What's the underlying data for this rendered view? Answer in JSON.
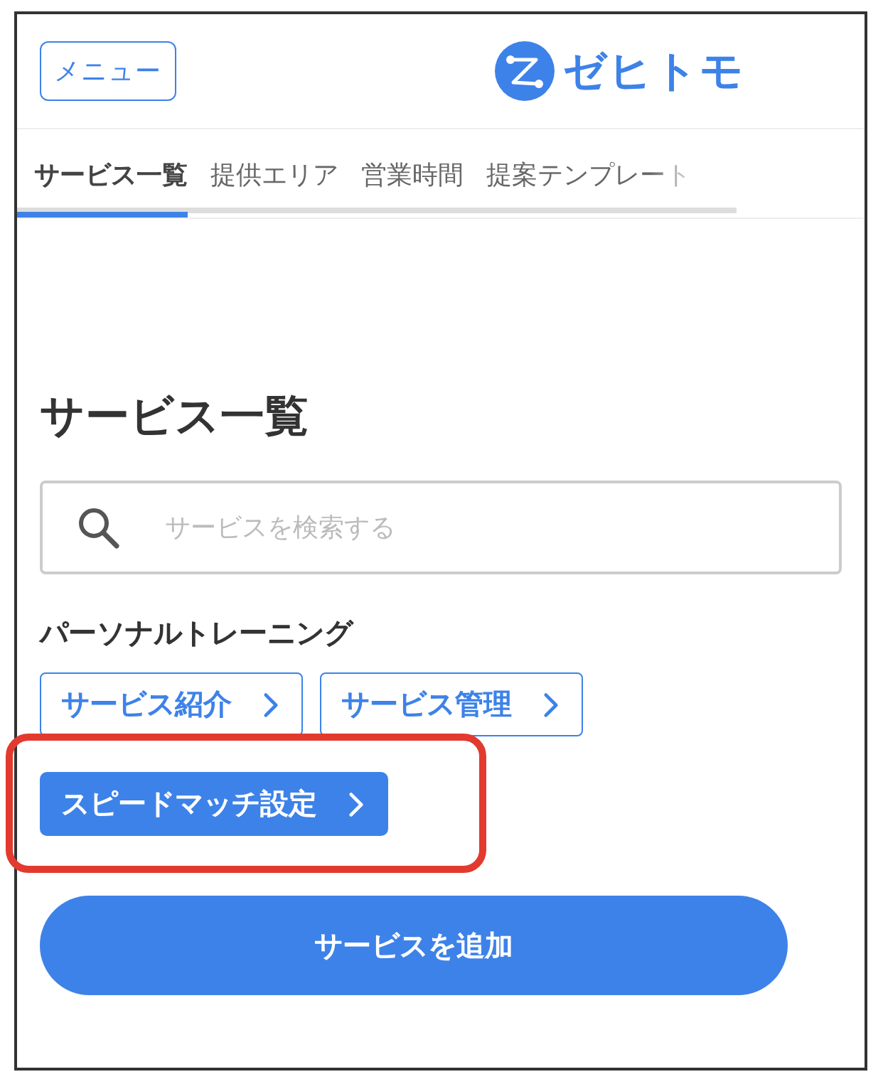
{
  "header": {
    "menu_button": "メニュー",
    "logo_text": "ゼヒトモ"
  },
  "tabs": [
    {
      "label": "サービス一覧",
      "selected": true
    },
    {
      "label": "提供エリア",
      "selected": false
    },
    {
      "label": "営業時間",
      "selected": false
    },
    {
      "label": "提案テンプレート",
      "selected": false
    }
  ],
  "title": "サービス一覧",
  "search": {
    "placeholder": "サービスを検索する"
  },
  "section": {
    "heading": "パーソナルトレーニング",
    "links": [
      {
        "label": "サービス紹介",
        "kind": "outline",
        "highlighted": false
      },
      {
        "label": "サービス管理",
        "kind": "outline",
        "highlighted": false
      },
      {
        "label": "スピードマッチ設定",
        "kind": "filled",
        "highlighted": true
      }
    ]
  },
  "add_button": "サービスを追加"
}
